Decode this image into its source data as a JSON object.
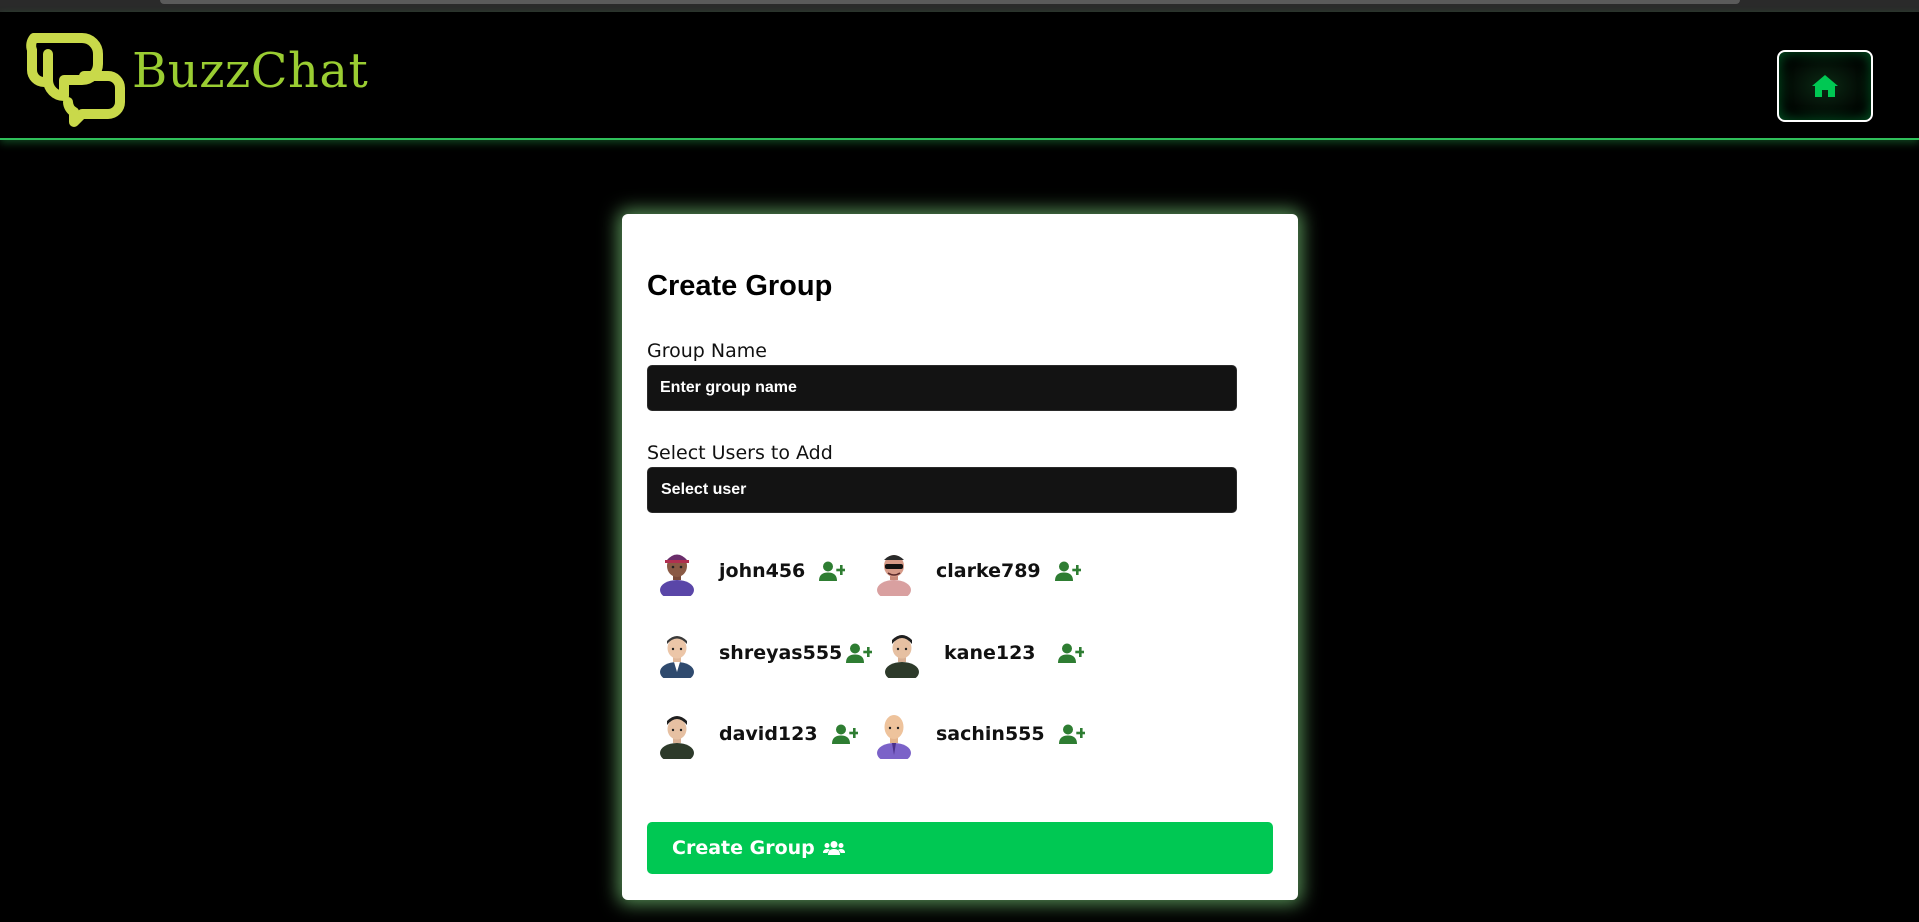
{
  "app": {
    "brand": "BuzzChat"
  },
  "nav": {
    "home_icon": "home-icon"
  },
  "form": {
    "title": "Create Group",
    "group_name_label": "Group Name",
    "group_name_placeholder": "Enter group name",
    "select_users_label": "Select Users to Add",
    "select_user_value": "Select user",
    "submit_label": "Create Group",
    "submit_icon": "users-icon"
  },
  "users": [
    {
      "username": "john456",
      "avatar": "avatar-cap-man",
      "action_icon": "user-plus-icon"
    },
    {
      "username": "clarke789",
      "avatar": "avatar-sunglasses",
      "action_icon": "user-plus-icon"
    },
    {
      "username": "shreyas555",
      "avatar": "avatar-suit-man",
      "action_icon": "user-plus-icon"
    },
    {
      "username": "kane123",
      "avatar": "avatar-dark-jacket",
      "action_icon": "user-plus-icon"
    },
    {
      "username": "david123",
      "avatar": "avatar-dark-jacket",
      "action_icon": "user-plus-icon"
    },
    {
      "username": "sachin555",
      "avatar": "avatar-bald-man",
      "action_icon": "user-plus-icon"
    }
  ],
  "colors": {
    "background": "#000000",
    "accent_green": "#00c853",
    "icon_green": "#2e7d32",
    "brand_text": "#9acd32",
    "logo": "#c9d94a",
    "glow": "#90ee90"
  }
}
